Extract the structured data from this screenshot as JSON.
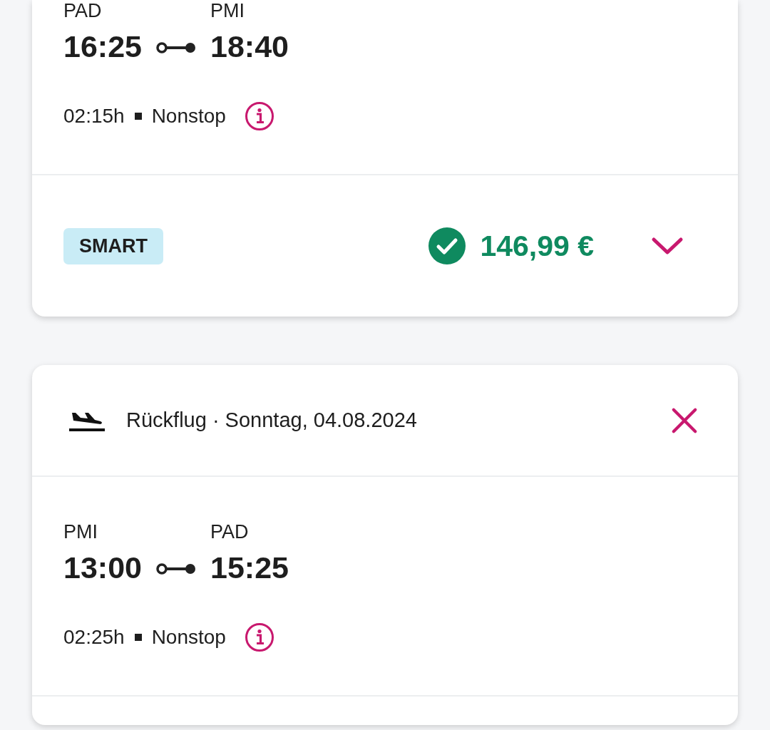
{
  "flights": [
    {
      "kind": "outbound",
      "origin": "PAD",
      "destination": "PMI",
      "departure": "16:25",
      "arrival": "18:40",
      "duration": "02:15h",
      "stops": "Nonstop",
      "fare": {
        "label": "SMART",
        "price": "146,99 €",
        "selected": true
      }
    },
    {
      "kind": "return",
      "title": "Rückflug · Sonntag, 04.08.2024",
      "origin": "PMI",
      "destination": "PAD",
      "departure": "13:00",
      "arrival": "15:25",
      "duration": "02:25h",
      "stops": "Nonstop"
    }
  ]
}
